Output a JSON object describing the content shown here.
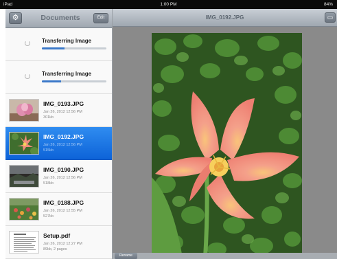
{
  "status_bar": {
    "device": "iPad",
    "time": "1:00 PM",
    "battery": "84%"
  },
  "sidebar": {
    "title": "Documents",
    "edit_label": "Edit",
    "transfers": [
      {
        "label": "Transferring Image",
        "progress": 0.35
      },
      {
        "label": "Transferring Image",
        "progress": 0.3
      }
    ],
    "files": [
      {
        "name": "IMG_0193.JPG",
        "date": "Jan 26, 2012 12:56 PM",
        "size": "301kb",
        "thumb_icon": "pink-flower-thumbnail"
      },
      {
        "name": "IMG_0192.JPG",
        "date": "Jan 26, 2012 12:56 PM",
        "size": "515kb",
        "thumb_icon": "tulip-thumbnail",
        "selected": true
      },
      {
        "name": "IMG_0190.JPG",
        "date": "Jan 26, 2012 12:56 PM",
        "size": "518kb",
        "thumb_icon": "landscape-thumbnail"
      },
      {
        "name": "IMG_0188.JPG",
        "date": "Jan 26, 2012 12:55 PM",
        "size": "527kb",
        "thumb_icon": "garden-thumbnail"
      },
      {
        "name": "Setup.pdf",
        "date": "Jan 26, 2012 12:27 PM",
        "size": "89kb, 2 pages",
        "thumb_icon": "pdf-document-thumbnail"
      }
    ]
  },
  "viewer": {
    "title": "IMG_0192.JPG",
    "rename_label": "Rename",
    "image_icon": "pink-tulip-photo"
  },
  "colors": {
    "selection": "#1a73e8",
    "header_gradient_top": "#c9cfd6",
    "progress_fill": "#3a78c8"
  }
}
